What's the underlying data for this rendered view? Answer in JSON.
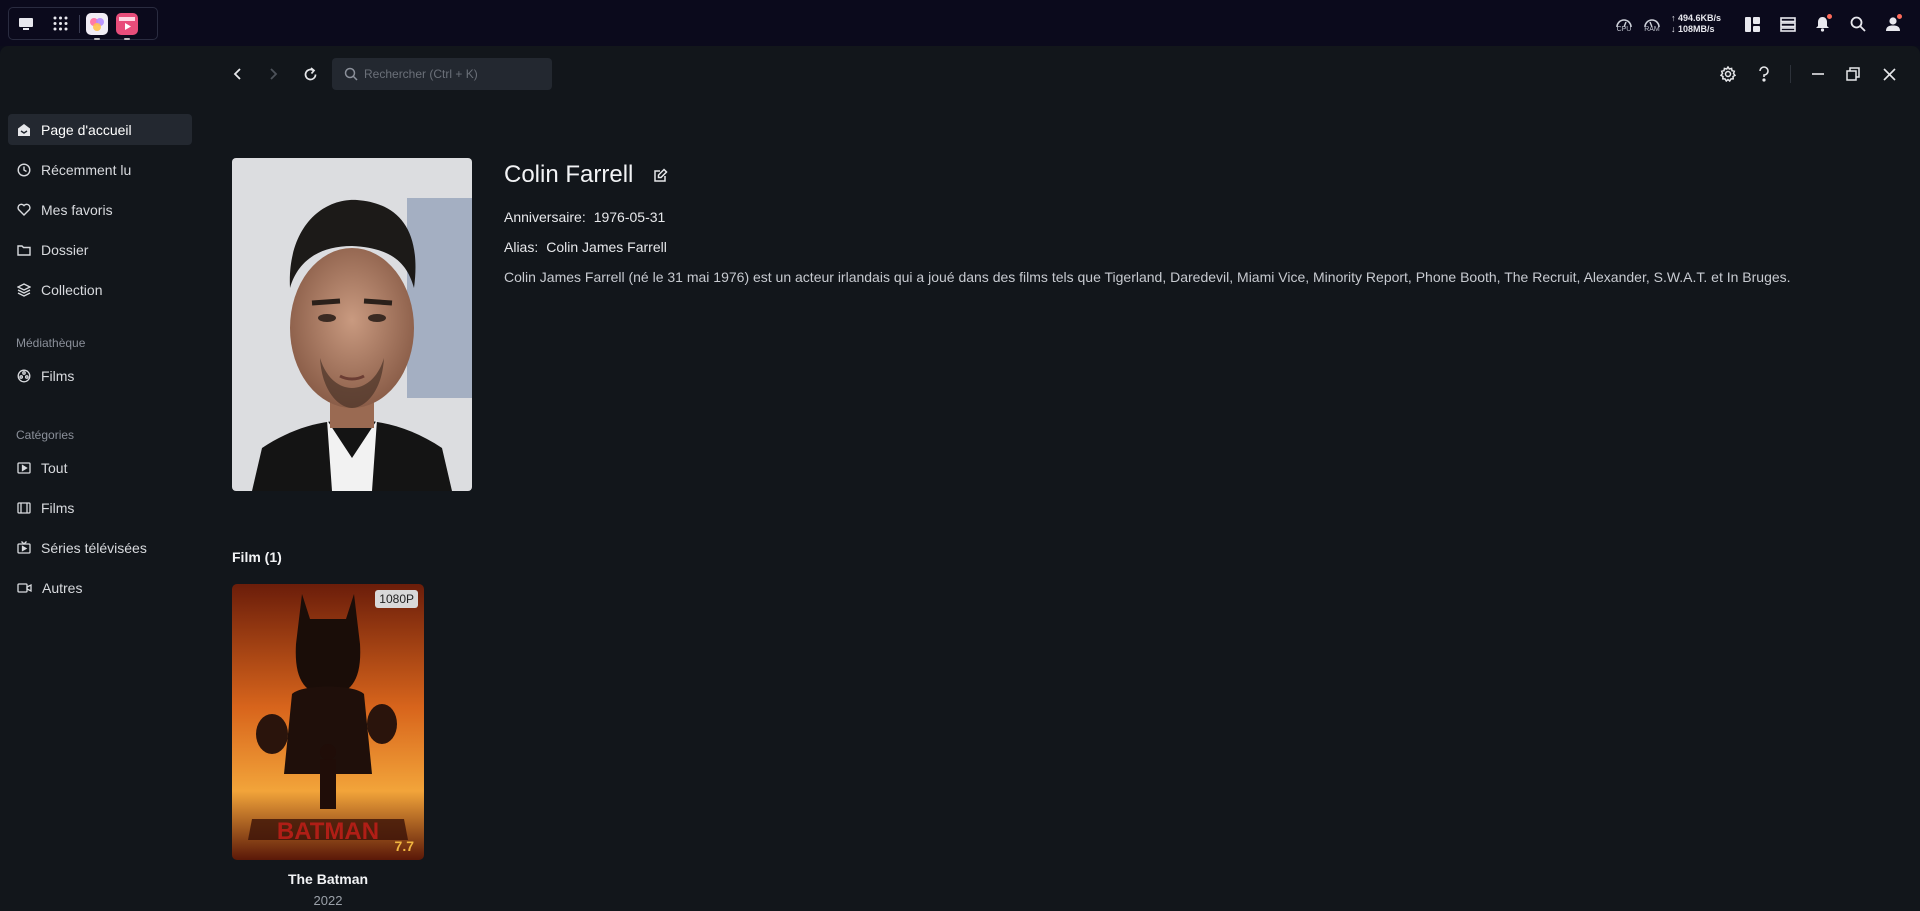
{
  "system_bar": {
    "meters": [
      {
        "name": "cpu",
        "label": "CPU"
      },
      {
        "name": "ram",
        "label": "RAM"
      }
    ],
    "net_up": "↑ 494.6KB/s",
    "net_down": "↓ 108MB/s",
    "accent": "#ff6b5b"
  },
  "toolbar": {
    "search_placeholder": "Rechercher (Ctrl + K)"
  },
  "sidebar": {
    "items": [
      {
        "label": "Page d'accueil",
        "icon": "home-icon",
        "active": true
      },
      {
        "label": "Récemment lu",
        "icon": "clock-icon"
      },
      {
        "label": "Mes favoris",
        "icon": "heart-icon"
      },
      {
        "label": "Dossier",
        "icon": "folder-icon"
      },
      {
        "label": "Collection",
        "icon": "layers-icon"
      }
    ],
    "section_library": "Médiathèque",
    "library_items": [
      {
        "label": "Films",
        "icon": "film-reel-icon"
      }
    ],
    "section_categories": "Catégories",
    "category_items": [
      {
        "label": "Tout",
        "icon": "play-square-icon"
      },
      {
        "label": "Films",
        "icon": "film-strip-icon"
      },
      {
        "label": "Séries télévisées",
        "icon": "tv-icon"
      },
      {
        "label": "Autres",
        "icon": "video-icon"
      }
    ]
  },
  "person": {
    "name": "Colin Farrell",
    "birthday_label": "Anniversaire:",
    "birthday": "1976-05-31",
    "alias_label": "Alias:",
    "alias": "Colin James Farrell",
    "bio": "Colin James Farrell (né le 31 mai 1976) est un acteur irlandais qui a joué dans des films tels que Tigerland, Daredevil, Miami Vice, Minority Report, Phone Booth, The Recruit, Alexander, S.W.A.T. et In Bruges."
  },
  "films": {
    "heading": "Film (1)",
    "items": [
      {
        "title": "The Batman",
        "year": "2022",
        "resolution": "1080P",
        "rating": "7.7",
        "poster_text": "BATMAN"
      }
    ]
  }
}
